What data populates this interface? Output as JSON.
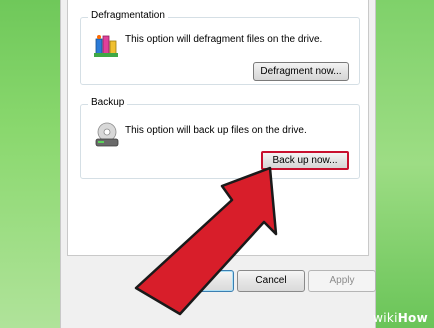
{
  "defrag": {
    "title": "Defragmentation",
    "description": "This option will defragment files on the drive.",
    "button_label": "Defragment now..."
  },
  "backup": {
    "title": "Backup",
    "description": "This option will back up files on the drive.",
    "button_label": "Back up now..."
  },
  "footer": {
    "ok_label": "OK",
    "cancel_label": "Cancel",
    "apply_label": "Apply"
  },
  "watermark": {
    "prefix": "wiki",
    "suffix": "How"
  },
  "colors": {
    "arrow": "#d81e2a",
    "highlight": "#c8102e",
    "background": "#86d36a"
  },
  "icons": [
    "defrag-icon",
    "backup-icon",
    "red-arrow-pointer"
  ]
}
